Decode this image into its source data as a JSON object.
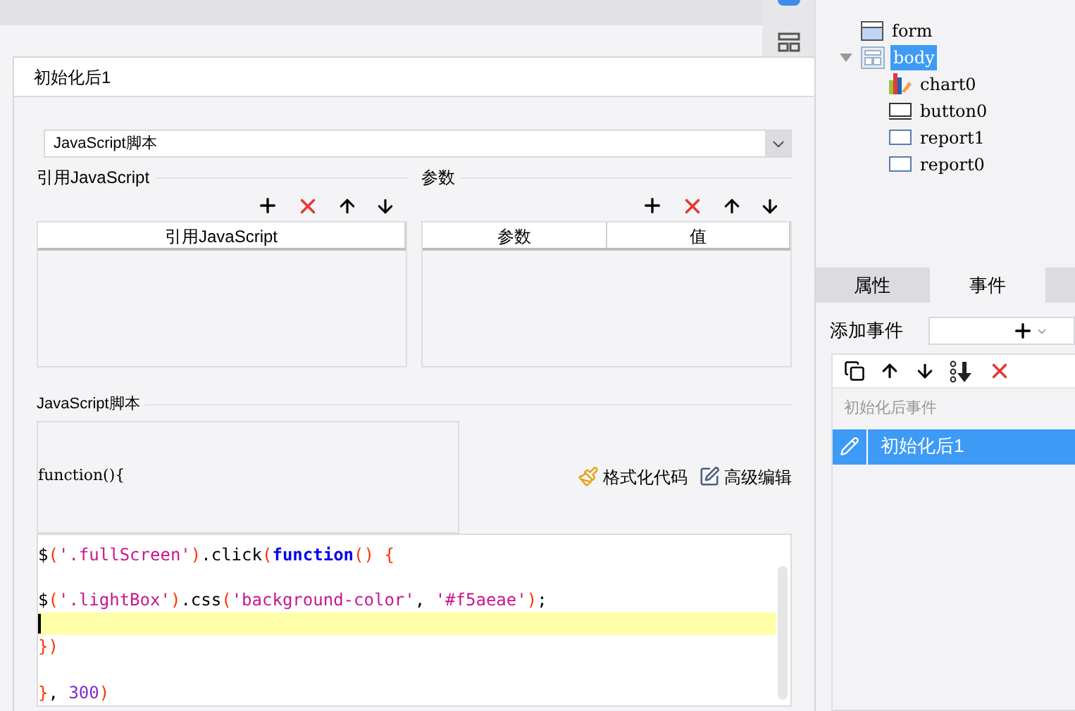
{
  "dialog": {
    "title": "初始化后1",
    "script_type": {
      "value": "JavaScript脚本"
    },
    "reference_group": {
      "title": "引用JavaScript",
      "columns": [
        "引用JavaScript"
      ]
    },
    "param_group": {
      "title": "参数",
      "columns": [
        "参数",
        "值"
      ]
    },
    "script_group": {
      "title": "JavaScript脚本",
      "signature": "function(){",
      "buttons": [
        {
          "kind": "format",
          "label": "格式化代码"
        },
        {
          "kind": "edit",
          "label": "高级编辑"
        }
      ]
    },
    "code_lines": [
      {
        "current": false,
        "tokens": [
          {
            "kind": "plain",
            "text": "$"
          },
          {
            "kind": "paren",
            "text": "("
          },
          {
            "kind": "string",
            "text": "'.fullScreen'"
          },
          {
            "kind": "paren",
            "text": ")"
          },
          {
            "kind": "plain",
            "text": ".click"
          },
          {
            "kind": "paren",
            "text": "("
          },
          {
            "kind": "keyword",
            "text": "function"
          },
          {
            "kind": "paren",
            "text": "() {"
          }
        ]
      },
      {
        "current": false
      },
      {
        "current": false,
        "tokens": [
          {
            "kind": "plain",
            "text": "$"
          },
          {
            "kind": "paren",
            "text": "("
          },
          {
            "kind": "string",
            "text": "'.lightBox'"
          },
          {
            "kind": "paren",
            "text": ")"
          },
          {
            "kind": "plain",
            "text": ".css"
          },
          {
            "kind": "paren",
            "text": "("
          },
          {
            "kind": "string",
            "text": "'background-color'"
          },
          {
            "kind": "plain",
            "text": ", "
          },
          {
            "kind": "string",
            "text": "'#f5aeae'"
          },
          {
            "kind": "paren",
            "text": ")"
          },
          {
            "kind": "plain",
            "text": ";"
          }
        ]
      },
      {
        "current": true
      },
      {
        "current": false,
        "tokens": [
          {
            "kind": "paren",
            "text": "})"
          }
        ]
      },
      {
        "current": false
      },
      {
        "current": false,
        "tokens": [
          {
            "kind": "paren",
            "text": "}"
          },
          {
            "kind": "plain",
            "text": ", "
          },
          {
            "kind": "number",
            "text": "300"
          },
          {
            "kind": "paren",
            "text": ")"
          }
        ]
      }
    ]
  },
  "tree": [
    {
      "label": "form",
      "kind": "form",
      "selected": false,
      "expanded": false
    },
    {
      "label": "body",
      "kind": "layout",
      "selected": true,
      "expanded": true,
      "children": [
        {
          "label": "chart0",
          "kind": "chart",
          "selected": false
        },
        {
          "label": "button0",
          "kind": "button",
          "selected": false
        },
        {
          "label": "report1",
          "kind": "report",
          "selected": false
        },
        {
          "label": "report0",
          "kind": "report",
          "selected": false
        }
      ]
    }
  ],
  "tabs": [
    {
      "label": "属性",
      "selected": false
    },
    {
      "label": "事件",
      "selected": true
    }
  ],
  "add_event": {
    "label": "添加事件"
  },
  "events": {
    "section": "初始化后事件",
    "items": [
      {
        "label": "初始化后1",
        "selected": true
      }
    ]
  }
}
